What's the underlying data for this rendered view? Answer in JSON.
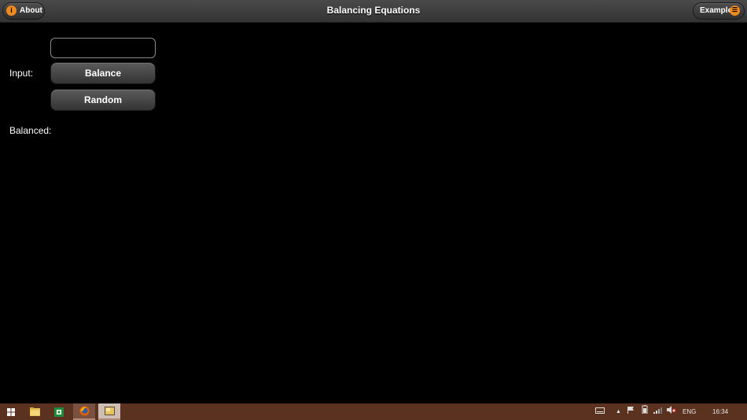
{
  "header": {
    "title": "Balancing Equations",
    "about_label": "About",
    "about_icon": "info-icon",
    "example_label": "Example",
    "example_icon": "list-icon"
  },
  "form": {
    "input_label": "Input:",
    "input_value": "",
    "input_placeholder": "",
    "balance_label": "Balance",
    "random_label": "Random",
    "balanced_label": "Balanced:"
  },
  "taskbar": {
    "apps": [
      "start-icon",
      "file-explorer-icon",
      "excel-icon",
      "firefox-icon",
      "app-window-icon"
    ],
    "language": "ENG",
    "time": "16:34"
  },
  "colors": {
    "accent": "#f08a1c",
    "background": "#000000",
    "taskbar": "#5b3120"
  }
}
